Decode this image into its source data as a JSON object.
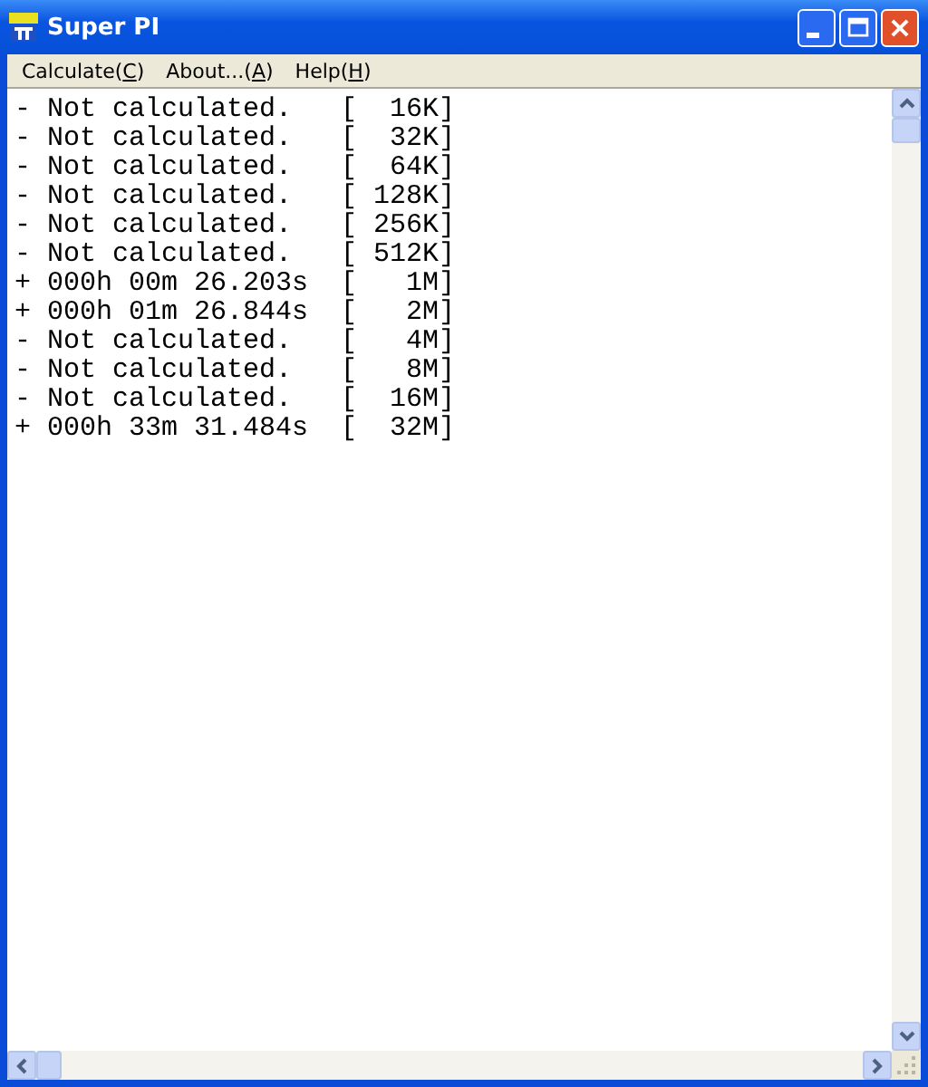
{
  "window": {
    "title": "Super PI"
  },
  "menu": [
    {
      "before": "Calculate(",
      "key": "C",
      "after": ")"
    },
    {
      "before": "About...(",
      "key": "A",
      "after": ")"
    },
    {
      "before": "Help(",
      "key": "H",
      "after": ")"
    }
  ],
  "lines": [
    "- Not calculated.   [  16K]",
    "- Not calculated.   [  32K]",
    "- Not calculated.   [  64K]",
    "- Not calculated.   [ 128K]",
    "- Not calculated.   [ 256K]",
    "- Not calculated.   [ 512K]",
    "+ 000h 00m 26.203s  [   1M]",
    "+ 000h 01m 26.844s  [   2M]",
    "- Not calculated.   [   4M]",
    "- Not calculated.   [   8M]",
    "- Not calculated.   [  16M]",
    "+ 000h 33m 31.484s  [  32M]"
  ]
}
